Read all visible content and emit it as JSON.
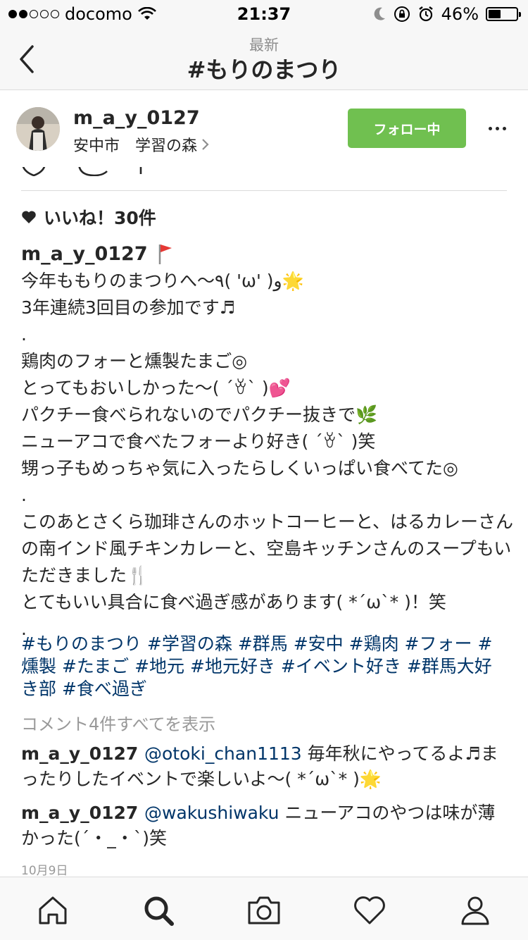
{
  "status_bar": {
    "carrier": "docomo",
    "time": "21:37",
    "battery_percent": "46%",
    "battery_level": 0.46
  },
  "nav": {
    "subtitle": "最新",
    "title": "#もりのまつり"
  },
  "post": {
    "username": "m_a_y_0127",
    "location": "安中市　学習の森",
    "follow_label": "フォロー中",
    "likes": "いいね！30件",
    "caption_user": "m_a_y_0127",
    "caption_lines": [
      "今年ももりのまつりへ〜٩( 'ω' )و🌟",
      "3年連続3回目の参加です♬",
      ".",
      "鶏肉のフォーと燻製たまご◎",
      "とってもおいしかった〜( ´ꈊ` )💕",
      "パクチー食べられないのでパクチー抜きで🌿",
      "ニューアコで食べたフォーより好き( ´ꈊ` )笑",
      "甥っ子もめっちゃ気に入ったらしくいっぱい食べてた◎",
      ".",
      "このあとさくら珈琲さんのホットコーヒーと、はるカレーさんの南インド風チキンカレーと、空島キッチンさんのスープもいただきました🍴",
      "とてもいい具合に食べ過ぎ感があります( *´ω`* )！笑",
      "."
    ],
    "hashtags": [
      "#もりのまつり",
      "#学習の森",
      "#群馬",
      "#安中",
      "#鶏肉",
      "#フォー",
      "#燻製",
      "#たまご",
      "#地元",
      "#地元好き",
      "#イベント好き",
      "#群馬大好き部",
      "#食べ過ぎ"
    ],
    "view_comments": "コメント4件すべてを表示",
    "comments": [
      {
        "user": "m_a_y_0127",
        "mention": "@otoki_chan1113",
        "text": "毎年秋にやってるよ♬まったりしたイベントで楽しいよ〜( *´ω`* )🌟"
      },
      {
        "user": "m_a_y_0127",
        "mention": "@wakushiwaku",
        "text": "ニューアコのやつは味が薄かった(´・_・`)笑"
      }
    ],
    "date": "10月9日"
  },
  "tabbar": {
    "icons": [
      "home-icon",
      "search-icon",
      "camera-icon",
      "heart-icon",
      "profile-icon"
    ]
  },
  "colors": {
    "follow_green": "#70c050",
    "link_blue": "#003569",
    "muted_gray": "#999999",
    "header_bg": "#f7f7f7"
  }
}
